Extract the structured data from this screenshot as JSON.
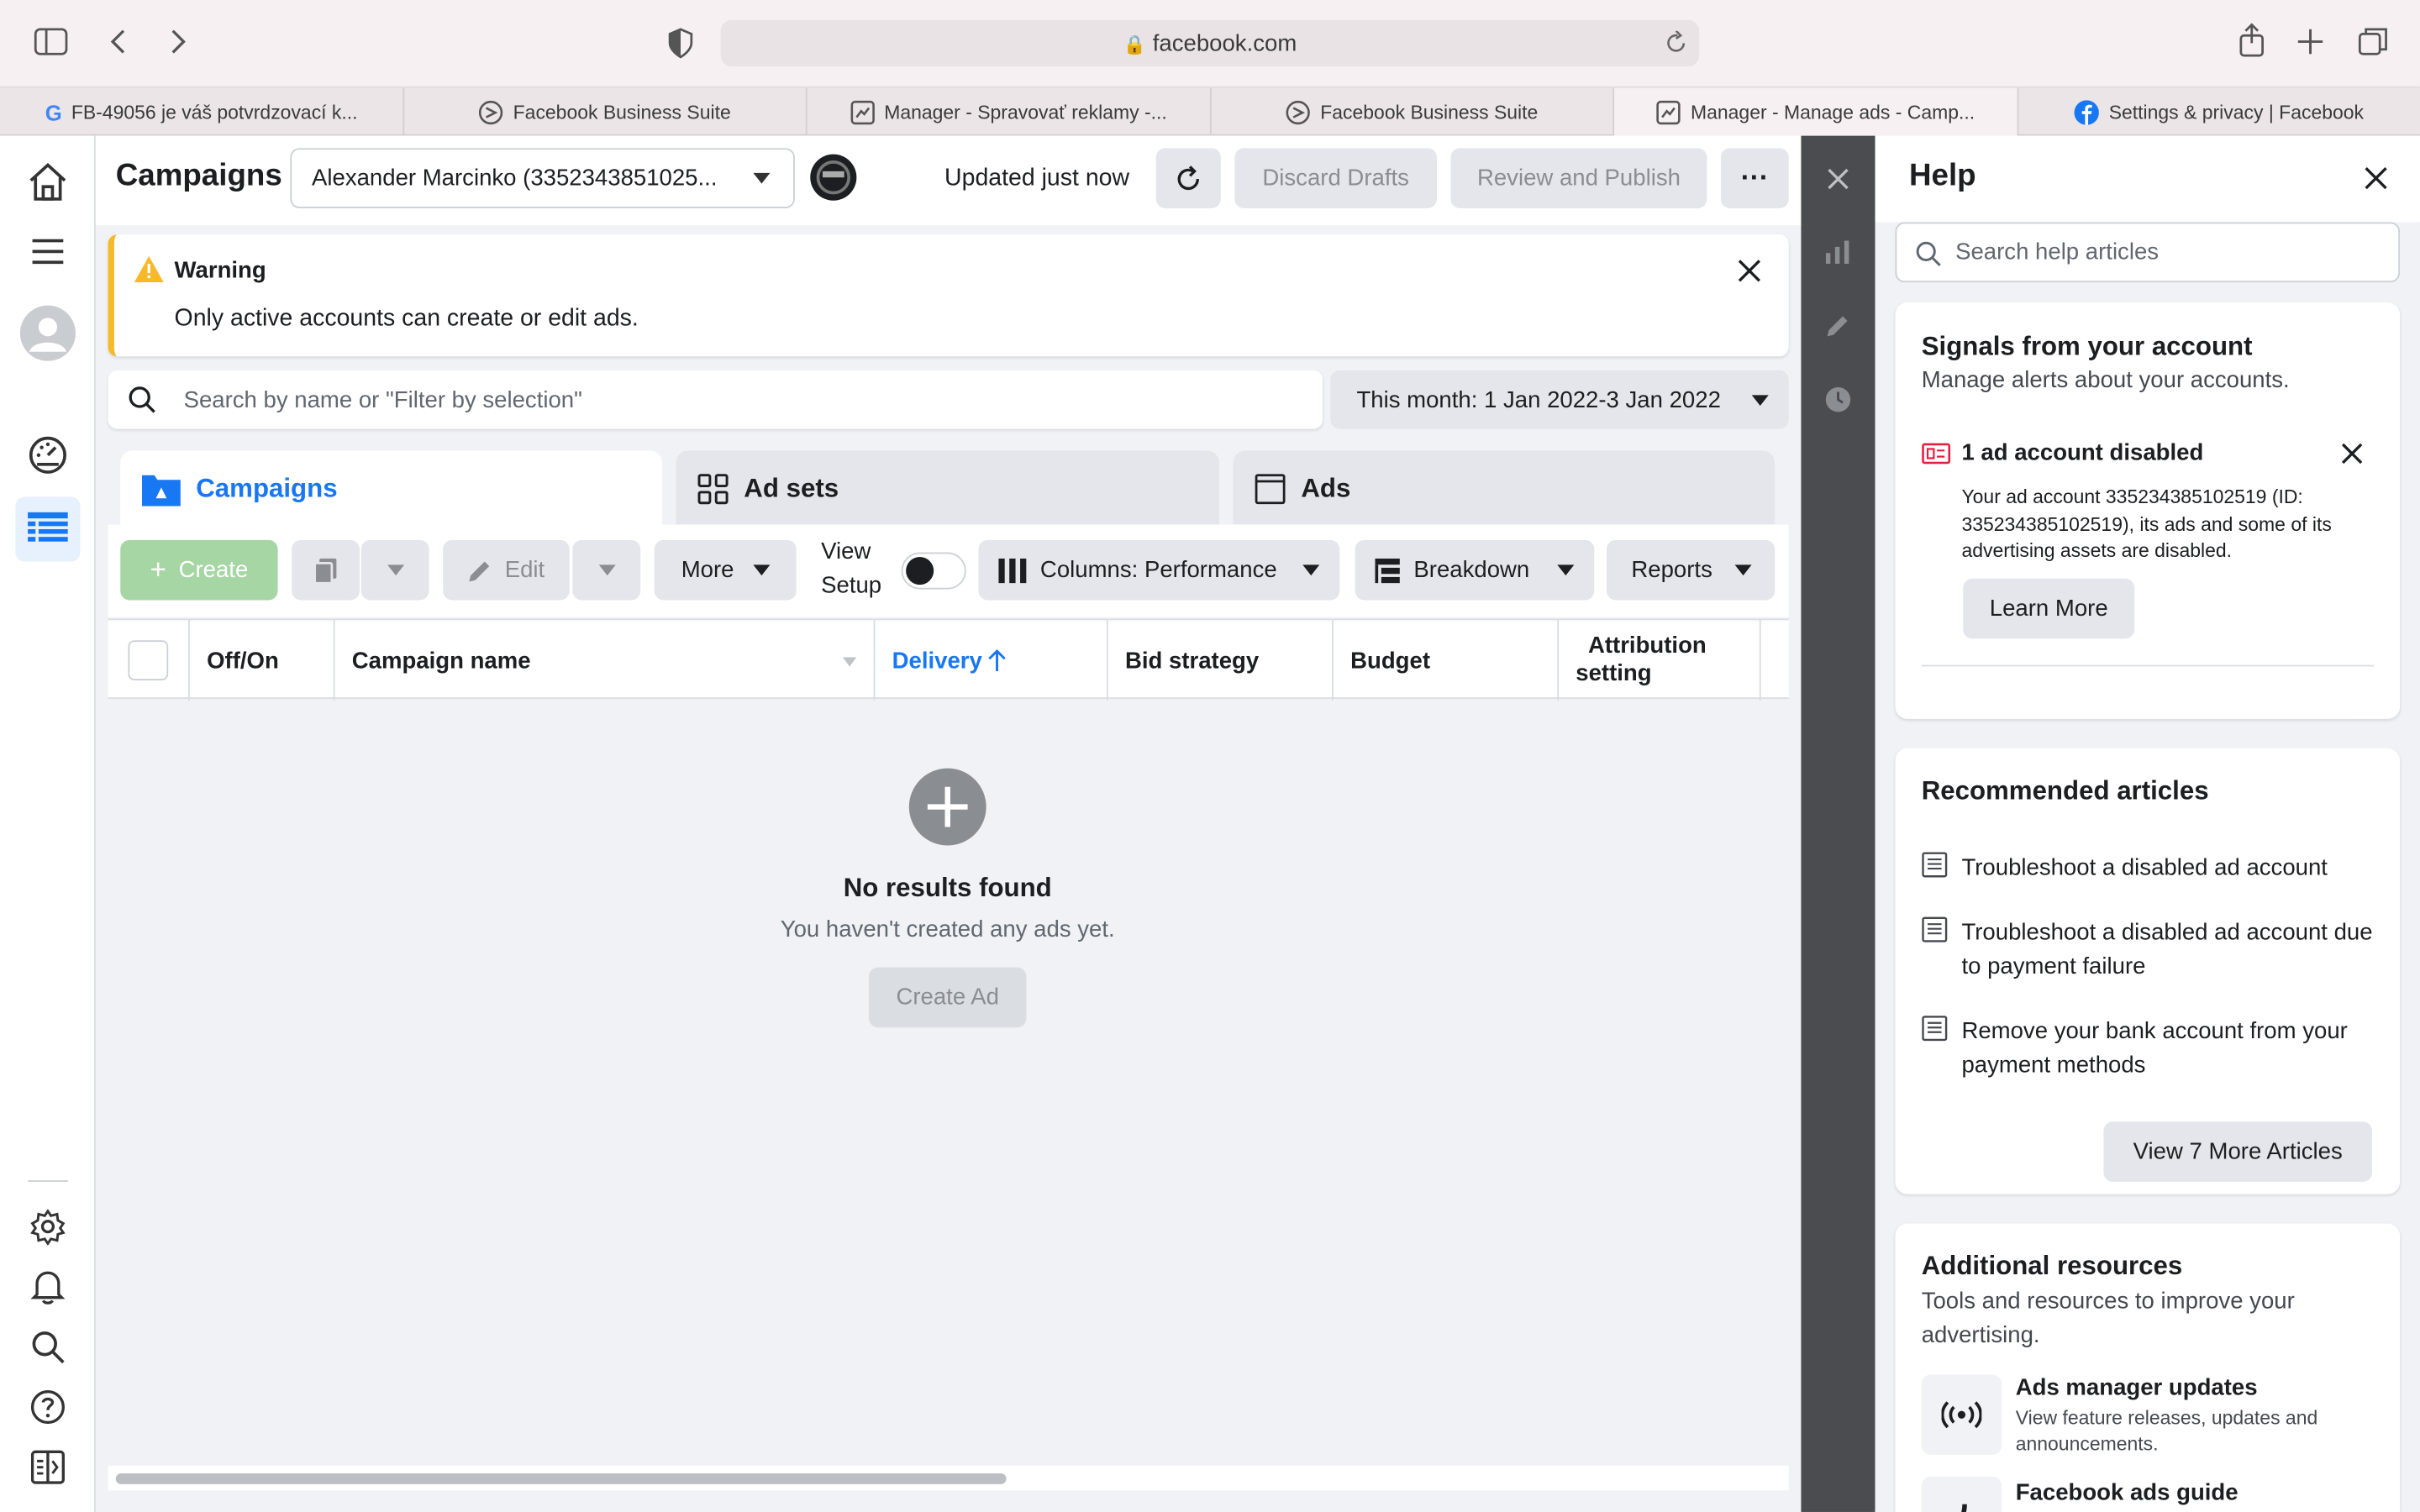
{
  "browser": {
    "url": "facebook.com",
    "tabs": [
      {
        "label": "FB-49056 je váš potvrdzovací k..."
      },
      {
        "label": "Facebook Business Suite"
      },
      {
        "label": "Manager - Spravovať reklamy -..."
      },
      {
        "label": "Facebook Business Suite"
      },
      {
        "label": "Manager - Manage ads - Camp..."
      },
      {
        "label": "Settings & privacy | Facebook"
      }
    ]
  },
  "header": {
    "title": "Campaigns",
    "account": "Alexander Marcinko (3352343851025...",
    "updated": "Updated just now",
    "discard": "Discard Drafts",
    "review": "Review and Publish",
    "more_icon": "ellipsis-icon"
  },
  "warning": {
    "title": "Warning",
    "message": "Only active accounts can create or edit ads."
  },
  "search": {
    "placeholder": "Search by name or \"Filter by selection\"",
    "date_range": "This month: 1 Jan 2022-3 Jan 2022"
  },
  "level_tabs": {
    "campaigns": "Campaigns",
    "adsets": "Ad sets",
    "ads": "Ads"
  },
  "toolbar": {
    "create": "Create",
    "edit": "Edit",
    "more": "More",
    "view_setup_1": "View",
    "view_setup_2": "Setup",
    "columns": "Columns: Performance",
    "breakdown": "Breakdown",
    "reports": "Reports"
  },
  "table": {
    "columns": [
      "Off/On",
      "Campaign name",
      "Delivery",
      "Bid strategy",
      "Budget",
      "Attribution",
      "setting"
    ]
  },
  "empty": {
    "title": "No results found",
    "subtitle": "You haven't created any ads yet.",
    "button": "Create Ad"
  },
  "help": {
    "title": "Help",
    "search_placeholder": "Search help articles",
    "signals": {
      "title": "Signals from your account",
      "subtitle": "Manage alerts about your accounts.",
      "alert_title": "1 ad account disabled",
      "alert_body": "Your ad account 335234385102519 (ID: 335234385102519), its ads and some of its advertising assets are disabled.",
      "learn_more": "Learn More"
    },
    "recommended": {
      "title": "Recommended articles",
      "articles": [
        "Troubleshoot a disabled ad account",
        "Troubleshoot a disabled ad account due to payment failure",
        "Remove your bank account from your payment methods"
      ],
      "view_more": "View 7 More Articles"
    },
    "resources": {
      "title": "Additional resources",
      "subtitle": "Tools and resources to improve your advertising.",
      "items": [
        {
          "title": "Ads manager updates",
          "desc": "View feature releases, updates and announcements."
        },
        {
          "title": "Facebook ads guide",
          "desc": ""
        }
      ]
    }
  },
  "colors": {
    "accent": "#1877f2",
    "warning": "#f7b928",
    "create_green": "#a6d6a4",
    "strip": "#4b4c4f"
  }
}
